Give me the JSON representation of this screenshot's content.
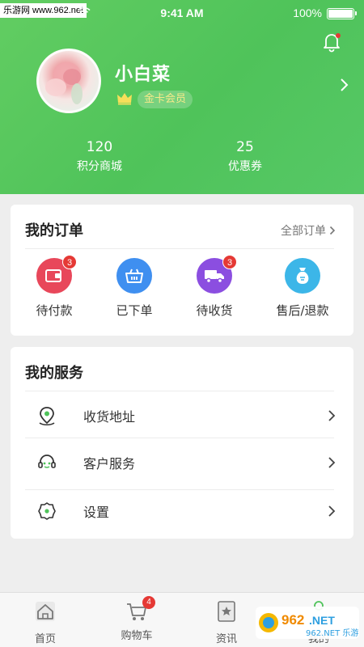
{
  "watermark_top": "乐游网 www.962.net",
  "status_bar": {
    "time": "9:41 AM",
    "battery": "100%"
  },
  "profile": {
    "username": "小白菜",
    "member_level": "金卡会员"
  },
  "stats": [
    {
      "value": "120",
      "label": "积分商城"
    },
    {
      "value": "25",
      "label": "优惠券"
    }
  ],
  "orders": {
    "title": "我的订单",
    "view_all": "全部订单",
    "items": [
      {
        "label": "待付款",
        "badge": "3",
        "color": "#e8475a",
        "icon": "wallet-icon"
      },
      {
        "label": "已下单",
        "badge": "",
        "color": "#3f8ff0",
        "icon": "basket-icon"
      },
      {
        "label": "待收货",
        "badge": "3",
        "color": "#8b4ee0",
        "icon": "truck-icon"
      },
      {
        "label": "售后/退款",
        "badge": "",
        "color": "#3cb6e8",
        "icon": "money-bag-icon"
      }
    ]
  },
  "services": {
    "title": "我的服务",
    "items": [
      {
        "label": "收货地址",
        "icon": "location-icon"
      },
      {
        "label": "客户服务",
        "icon": "headset-icon"
      },
      {
        "label": "设置",
        "icon": "settings-icon"
      }
    ]
  },
  "tabbar": {
    "items": [
      {
        "label": "首页",
        "icon": "home-icon",
        "badge": ""
      },
      {
        "label": "购物车",
        "icon": "cart-icon",
        "badge": "4"
      },
      {
        "label": "资讯",
        "icon": "news-icon",
        "badge": ""
      },
      {
        "label": "我的",
        "icon": "profile-icon",
        "badge": ""
      }
    ]
  },
  "watermark_bottom": "962.NET 乐游网",
  "colors": {
    "header_green": "#55c862",
    "badge_red": "#e53935",
    "member_gold": "#f6e98a"
  }
}
